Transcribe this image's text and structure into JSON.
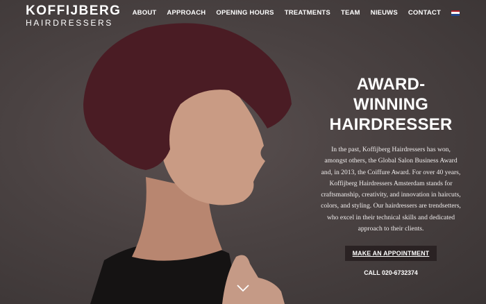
{
  "logo": {
    "brand": "KOFFIJBERG",
    "tagline": "HAIRDRESSERS"
  },
  "nav": {
    "items": [
      "ABOUT",
      "APPROACH",
      "OPENING HOURS",
      "TREATMENTS",
      "TEAM",
      "NIEUWS",
      "CONTACT"
    ],
    "language_icon": "netherlands-flag-icon",
    "flag_colors": [
      "#ae1c28",
      "#ffffff",
      "#21468b"
    ]
  },
  "hero": {
    "title_line1": "AWARD-WINNING",
    "title_line2": "HAIRDRESSER",
    "body": "In the past, Koffijberg Hairdressers has won, amongst others, the Global Salon Business Award and, in 2013, the Coiffure Award. For over 40 years, Koffijberg Hairdressers Amsterdam stands for craftsmanship, creativity, and innovation in haircuts, colors, and styling. Our hairdressers are trendsetters, who excel in their technical skills and dedicated approach to their clients.",
    "cta_label": "MAKE AN APPOINTMENT",
    "phone": "CALL 020-6732374"
  },
  "scroll_icon": "chevron-down-icon",
  "colors": {
    "background": "#4a4242",
    "cta_bg": "#2a2223",
    "hair": "#4a1c24",
    "skin": "#c99b84"
  }
}
